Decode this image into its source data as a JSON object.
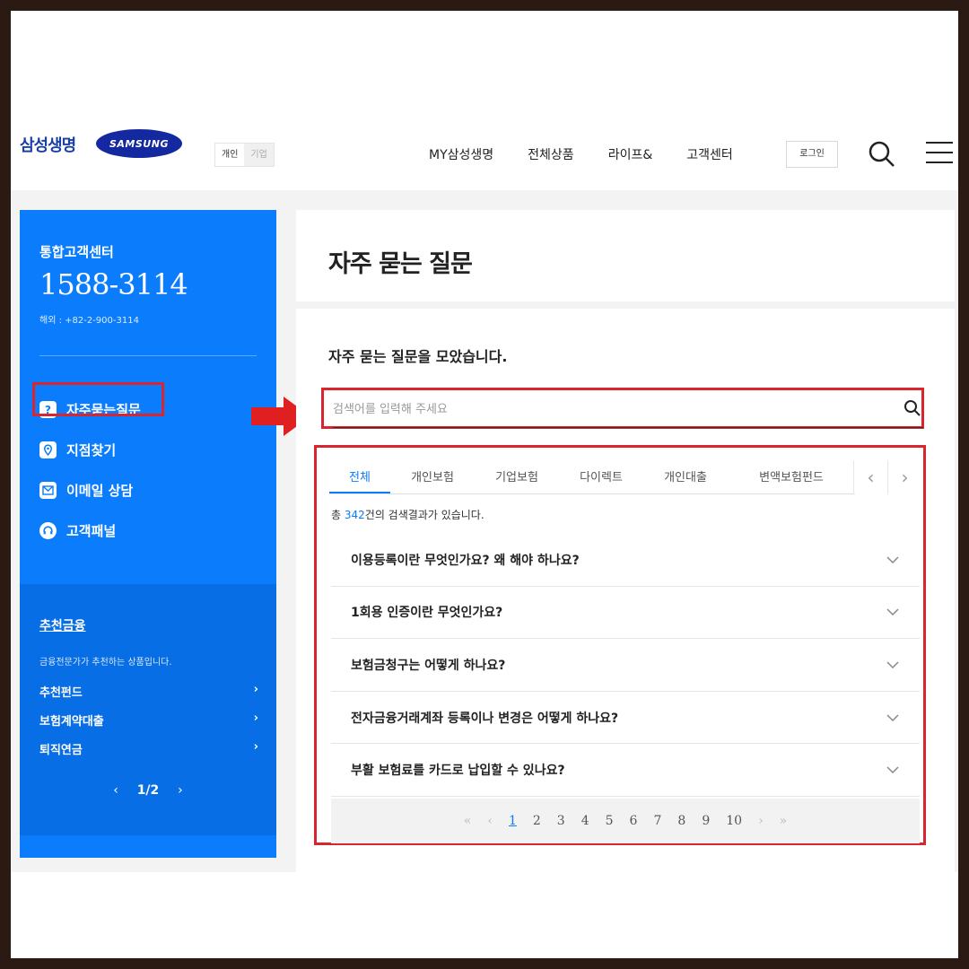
{
  "header": {
    "brand": "삼성생명",
    "samsung_logo": "SAMSUNG",
    "toggle": [
      "개인",
      "기업"
    ],
    "nav": [
      "MY삼성생명",
      "전체상품",
      "라이프&",
      "고객센터"
    ],
    "login": "로그인"
  },
  "sidebar": {
    "label": "통합고객센터",
    "phone": "1588-3114",
    "overseas": "해외 : +82-2-900-3114",
    "menu": [
      {
        "label": "자주묻는질문",
        "icon": "question-icon"
      },
      {
        "label": "지점찾기",
        "icon": "location-pin-icon"
      },
      {
        "label": "이메일 상담",
        "icon": "mail-icon"
      },
      {
        "label": "고객패널",
        "icon": "headset-icon"
      }
    ],
    "recommend": {
      "title": "추천금융",
      "desc": "금융전문가가 추천하는 상품입니다.",
      "items": [
        "추천펀드",
        "보험계약대출",
        "퇴직연금"
      ],
      "pager": "1/2"
    }
  },
  "main": {
    "title": "자주 묻는 질문",
    "subtitle": "자주 묻는 질문을 모았습니다.",
    "search_placeholder": "검색어를 입력해 주세요",
    "tabs": [
      "전체",
      "개인보험",
      "기업보험",
      "다이렉트",
      "개인대출",
      "변액보험펀드"
    ],
    "active_tab": "전체",
    "count_prefix": "총",
    "count_value": "342",
    "count_suffix": "건의 검색결과가 있습니다.",
    "faqs": [
      "이용등록이란 무엇인가요? 왜 해야 하나요?",
      "1회용 인증이란 무엇인가요?",
      "보험금청구는 어떻게 하나요?",
      "전자금융거래계좌 등록이나 변경은 어떻게 하나요?",
      "부활 보험료를 카드로 납입할 수 있나요?"
    ],
    "pages": [
      "1",
      "2",
      "3",
      "4",
      "5",
      "6",
      "7",
      "8",
      "9",
      "10"
    ],
    "current_page": "1"
  },
  "colors": {
    "accent_blue": "#0a7cfc",
    "highlight_red": "#d9262e"
  }
}
